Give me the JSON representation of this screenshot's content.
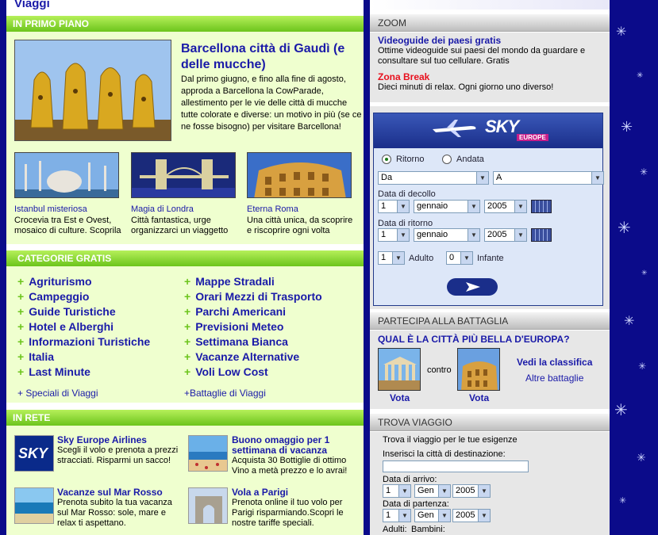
{
  "page": {
    "title": "Viaggi"
  },
  "primo_piano": {
    "header": "IN PRIMO PIANO",
    "feature": {
      "title": "Barcellona città di Gaudì (e delle mucche)",
      "text": "Dal primo giugno, e fino alla fine di agosto, approda a Barcellona la CowParade, allestimento per le vie delle città di mucche tutte colorate e diverse: un motivo in più (se ce ne fosse bisogno) per visitare Barcellona!"
    },
    "items": [
      {
        "title": "Istanbul misteriosa",
        "text": "Crocevia tra Est e Ovest, mosaico di culture. Scoprila"
      },
      {
        "title": "Magia di Londra",
        "text": "Città fantastica, urge organizzarci un viaggetto"
      },
      {
        "title": "Eterna Roma",
        "text": "Una città unica, da scoprire e riscoprire ogni volta"
      }
    ]
  },
  "categorie": {
    "header": "CATEGORIE GRATIS",
    "left": [
      "Agriturismo",
      "Campeggio",
      "Guide Turistiche",
      "Hotel e Alberghi",
      "Informazioni Turistiche",
      "Italia",
      "Last Minute"
    ],
    "right": [
      "Mappe Stradali",
      "Orari Mezzi di Trasporto",
      "Parchi Americani",
      "Previsioni Meteo",
      "Settimana Bianca",
      "Vacanze Alternative",
      "Voli Low Cost"
    ],
    "more_left": "+ Speciali di Viaggi",
    "more_right": "+Battaglie di Viaggi"
  },
  "in_rete": {
    "header": "IN RETE",
    "items": [
      {
        "title": "Sky Europe Airlines",
        "text": "Scegli il volo e prenota a prezzi stracciati. Risparmi un sacco!"
      },
      {
        "title": "Buono omaggio per 1 settimana di vacanza",
        "text": "Acquista 30 Bottiglie di ottimo Vino a metà prezzo e lo avrai!"
      },
      {
        "title": "Vacanze sul Mar Rosso",
        "text": "Prenota subito la tua vacanza sul Mar Rosso: sole, mare e relax ti aspettano."
      },
      {
        "title": "Vola a Parigi",
        "text": "Prenota online il tuo volo per Parigi risparmiando.Scopri le nostre tariffe speciali."
      }
    ]
  },
  "zoom": {
    "header": "ZOOM",
    "items": [
      {
        "title": "Videoguide dei paesi gratis",
        "text": "Ottime videoguide sui paesi del mondo da guardare e consultare sul tuo cellulare. Gratis"
      },
      {
        "title": "Zona Break",
        "text": "Dieci minuti di relax. Ogni giorno uno diverso!"
      }
    ]
  },
  "sky": {
    "logo_text": "SKY",
    "logo_sub": "EUROPE",
    "radio_return": "Ritorno",
    "radio_oneway": "Andata",
    "from": "Da",
    "to": "A",
    "depart_label": "Data di decollo",
    "return_label": "Data di ritorno",
    "day": "1",
    "month": "gennaio",
    "year": "2005",
    "adults_value": "1",
    "adults_label": "Adulto",
    "infant_value": "0",
    "infant_label": "Infante"
  },
  "battaglia": {
    "header": "PARTECIPA ALLA BATTAGLIA",
    "question": "QUAL È LA CITTÀ PIÙ BELLA D'EUROPA?",
    "vs": "contro",
    "vote": "Vota",
    "ranking": "Vedi la classifica",
    "others": "Altre battaglie"
  },
  "trova": {
    "header": "TROVA VIAGGIO",
    "intro": "Trova il viaggio per le tue esigenze",
    "dest_label": "Inserisci la città di destinazione:",
    "arrival_label": "Data di arrivo:",
    "departure_label": "Data di partenza:",
    "day": "1",
    "month": "Gen",
    "year": "2005",
    "adults": "Adulti:",
    "children": "Bambini:"
  },
  "colors": {
    "accent_green": "#6cc41c",
    "link_blue": "#1a1aa8",
    "red": "#e8101e",
    "background": "#0b0b8a"
  }
}
